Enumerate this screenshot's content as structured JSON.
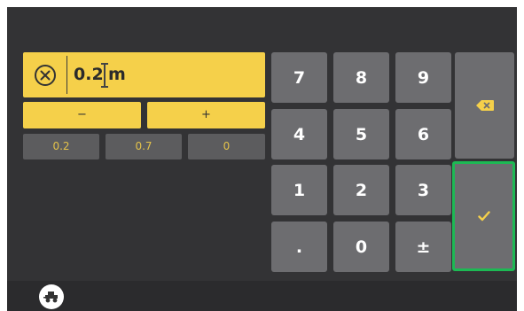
{
  "input": {
    "value": "0.2",
    "unit": "m"
  },
  "adjust": {
    "decrement_label": "−",
    "increment_label": "+"
  },
  "presets": [
    "0.2",
    "0.7",
    "0"
  ],
  "keypad": {
    "keys": [
      "7",
      "8",
      "9",
      "4",
      "5",
      "6",
      "1",
      "2",
      "3",
      ".",
      "0",
      "±"
    ]
  },
  "icons": {
    "clear": "clear-circle-x-icon",
    "backspace": "backspace-icon",
    "confirm": "checkmark-icon",
    "vehicle": "tractor-icon"
  },
  "colors": {
    "accent_yellow": "#f5d04a",
    "confirm_border": "#1db954",
    "key_gray": "#6d6d70",
    "background": "#333335"
  }
}
